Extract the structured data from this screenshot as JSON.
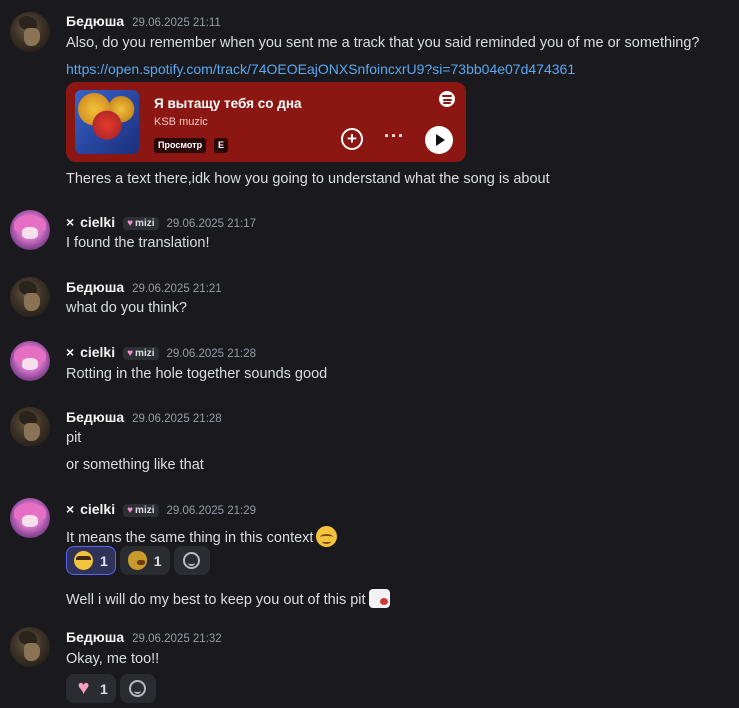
{
  "messages": [
    {
      "author": "Бедюша",
      "timestamp": "29.06.2025 21:11",
      "lines": [
        "Also, do you remember when you sent me a track that you said reminded you of me or something?"
      ],
      "link": "https://open.spotify.com/track/74OEOEajONXSnfoincxrU9?si=73bb04e07d474361",
      "after_embed": "Theres a text there,idk how you going to understand what the song is about"
    },
    {
      "author": "cielki",
      "prefix": "×",
      "tag": "mizi",
      "timestamp": "29.06.2025 21:17",
      "lines": [
        "I found the translation!"
      ]
    },
    {
      "author": "Бедюша",
      "timestamp": "29.06.2025 21:21",
      "lines": [
        "what do you think?"
      ]
    },
    {
      "author": "cielki",
      "prefix": "×",
      "tag": "mizi",
      "timestamp": "29.06.2025 21:28",
      "lines": [
        "Rotting in the hole together sounds good"
      ]
    },
    {
      "author": "Бедюша",
      "timestamp": "29.06.2025 21:28",
      "lines": [
        "pit",
        "or something like that"
      ]
    },
    {
      "author": "cielki",
      "prefix": "×",
      "tag": "mizi",
      "timestamp": "29.06.2025 21:29",
      "lines": [
        "It means the same thing in this context",
        "Well i will do my best to keep you out of this pit"
      ],
      "reactions": [
        {
          "emoji": "nerd-face",
          "count": "1",
          "active": true
        },
        {
          "emoji": "duck",
          "count": "1",
          "active": false
        }
      ]
    },
    {
      "author": "Бедюша",
      "timestamp": "29.06.2025 21:32",
      "lines": [
        "Okay, me too!!"
      ],
      "reactions": [
        {
          "emoji": "pink-heart",
          "count": "1",
          "active": false
        }
      ]
    }
  ],
  "spotify_embed": {
    "title": "Я вытащу тебя со дна",
    "artist": "KSB muzic",
    "preview_label": "Просмотр",
    "explicit_label": "E",
    "background": "#8c1712"
  },
  "colors": {
    "background": "#1a1a1e",
    "link": "#5aa8f0",
    "reaction_active_border": "#5865f2"
  }
}
